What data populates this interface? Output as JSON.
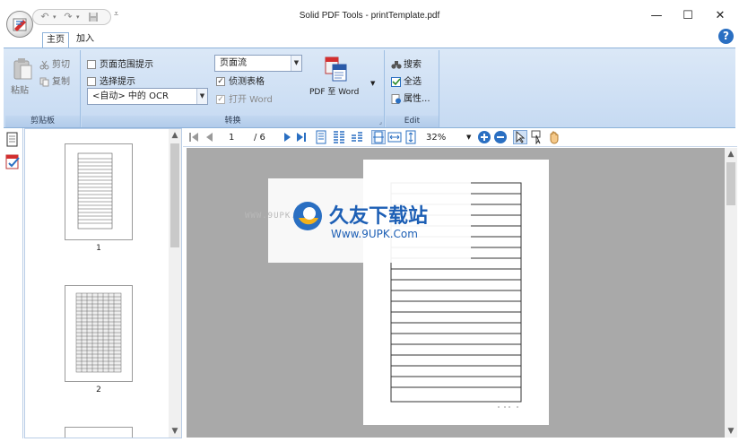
{
  "window": {
    "title": "Solid PDF Tools - printTemplate.pdf",
    "minimize_glyph": "—",
    "maximize_glyph": "☐",
    "close_glyph": "✕"
  },
  "quick_access": {
    "undo_glyph": "↶",
    "redo_glyph": "↷",
    "save_icon": "save-icon",
    "more_glyph": "▾"
  },
  "tabs": [
    {
      "label": "主页",
      "active": true
    },
    {
      "label": "加入",
      "active": false
    }
  ],
  "help": {
    "glyph": "?"
  },
  "ribbon": {
    "clipboard": {
      "title": "剪贴板",
      "paste_label": "粘贴",
      "cut_label": "剪切",
      "copy_label": "复制"
    },
    "convert": {
      "title": "转换",
      "page_range_hint": {
        "label": "页面范围提示",
        "checked": false
      },
      "selection_hint": {
        "label": "选择提示",
        "checked": false
      },
      "ocr_select": "<自动> 中的 OCR",
      "layout_select": "页面流",
      "detect_tables": {
        "label": "侦测表格",
        "checked": true
      },
      "open_word": {
        "label": "打开 Word",
        "checked": true
      },
      "pdf_to_word_label": "PDF 至 Word"
    },
    "edit": {
      "title": "Edit",
      "search_label": "搜索",
      "select_all_label": "全选",
      "properties_label": "属性..."
    }
  },
  "thumbnails": [
    {
      "page_number": "1"
    },
    {
      "page_number": "2"
    }
  ],
  "viewer_toolbar": {
    "current_page": "1",
    "total_pages": "/ 6",
    "zoom": "32%"
  },
  "watermark": {
    "site_small": "WWW.9UPK.COM",
    "brand": "久友下载站",
    "url": "Www.9UPK.Com"
  },
  "colors": {
    "ribbon_bg": "#c6daf2",
    "accent_blue": "#2a6fc2",
    "doc_area_gray": "#a9a9a9"
  }
}
